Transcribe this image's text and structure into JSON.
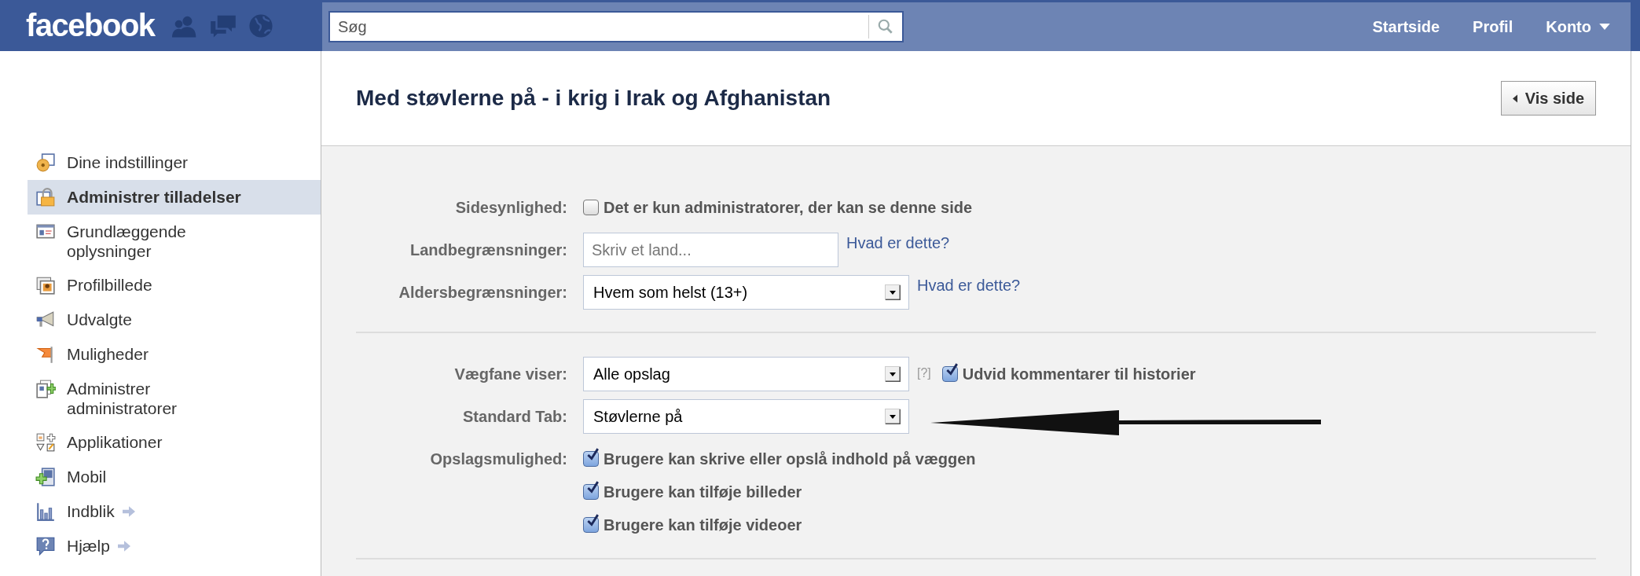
{
  "header": {
    "logo": "facebook",
    "search": {
      "placeholder": "Søg"
    },
    "nav": [
      {
        "label": "Startside",
        "dropdown": false
      },
      {
        "label": "Profil",
        "dropdown": false
      },
      {
        "label": "Konto",
        "dropdown": true
      }
    ]
  },
  "sidebar": {
    "items": [
      {
        "label": "Dine indstillinger",
        "selected": false,
        "external": false
      },
      {
        "label": "Administrer tilladelser",
        "selected": true,
        "external": false
      },
      {
        "label": "Grundlæggende oplysninger",
        "selected": false,
        "external": false
      },
      {
        "label": "Profilbillede",
        "selected": false,
        "external": false
      },
      {
        "label": "Udvalgte",
        "selected": false,
        "external": false
      },
      {
        "label": "Muligheder",
        "selected": false,
        "external": false
      },
      {
        "label": "Administrer administratorer",
        "selected": false,
        "external": false
      },
      {
        "label": "Applikationer",
        "selected": false,
        "external": false
      },
      {
        "label": "Mobil",
        "selected": false,
        "external": false
      },
      {
        "label": "Indblik",
        "selected": false,
        "external": true
      },
      {
        "label": "Hjælp",
        "selected": false,
        "external": true
      }
    ]
  },
  "page": {
    "title": "Med støvlerne på - i krig i Irak og Afghanistan",
    "view_button": "Vis side"
  },
  "settings": {
    "sections": [
      {
        "rows": [
          {
            "kind": "checkbox",
            "label": "Sidesynlighed:",
            "options": [
              {
                "text": "Det er kun administratorer, der kan se denne side",
                "checked": false
              }
            ]
          },
          {
            "kind": "input",
            "label": "Landbegrænsninger:",
            "placeholder": "Skriv et land...",
            "help": "Hvad er dette?"
          },
          {
            "kind": "select",
            "label": "Aldersbegrænsninger:",
            "value": "Hvem som helst (13+)",
            "help": "Hvad er dette?"
          }
        ]
      },
      {
        "rows": [
          {
            "kind": "select",
            "label": "Vægfane viser:",
            "value": "Alle opslag",
            "hint": "[?]",
            "option": {
              "text": "Udvid kommentarer til historier",
              "checked": true
            }
          },
          {
            "kind": "select",
            "label": "Standard Tab:",
            "value": "Støvlerne på"
          },
          {
            "kind": "checkbox",
            "label": "Opslagsmulighed:",
            "options": [
              {
                "text": "Brugere kan skrive eller opslå indhold på væggen",
                "checked": true
              },
              {
                "text": "Brugere kan tilføje billeder",
                "checked": true
              },
              {
                "text": "Brugere kan tilføje videoer",
                "checked": true
              }
            ]
          }
        ]
      }
    ]
  }
}
